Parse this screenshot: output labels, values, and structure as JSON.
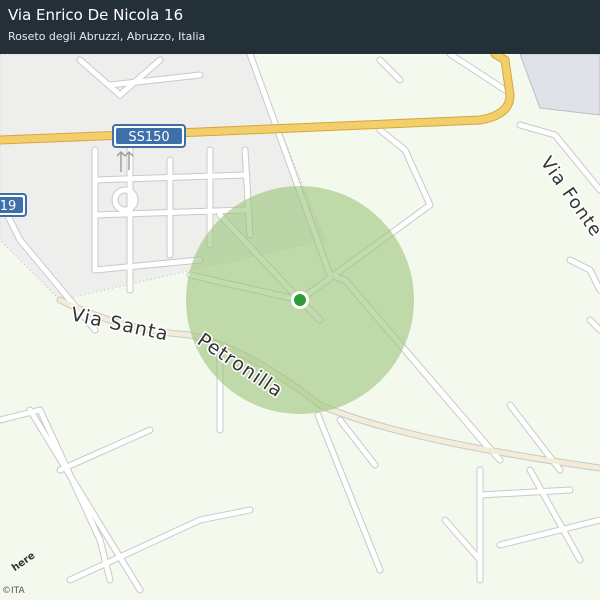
{
  "header": {
    "address": "Via Enrico De Nicola 16",
    "locality": "Roseto degli Abruzzi, Abruzzo, Italia"
  },
  "map": {
    "road_labels": {
      "ss150": "SS150",
      "road_19": "19",
      "via_santa": "Via Santa",
      "petronilla": "Petronilla",
      "via_fonte": "Via Fonte"
    },
    "provider_logo": "here",
    "copyright": "©ITA",
    "colors": {
      "background": "#f4f9ee",
      "urban_area": "#eeeeec",
      "highway": "#f2cf6a",
      "shield": "#3d6fa8",
      "accuracy_circle": "#9bc47a",
      "location_dot": "#2f9b3b",
      "header_bg": "#243038"
    }
  }
}
